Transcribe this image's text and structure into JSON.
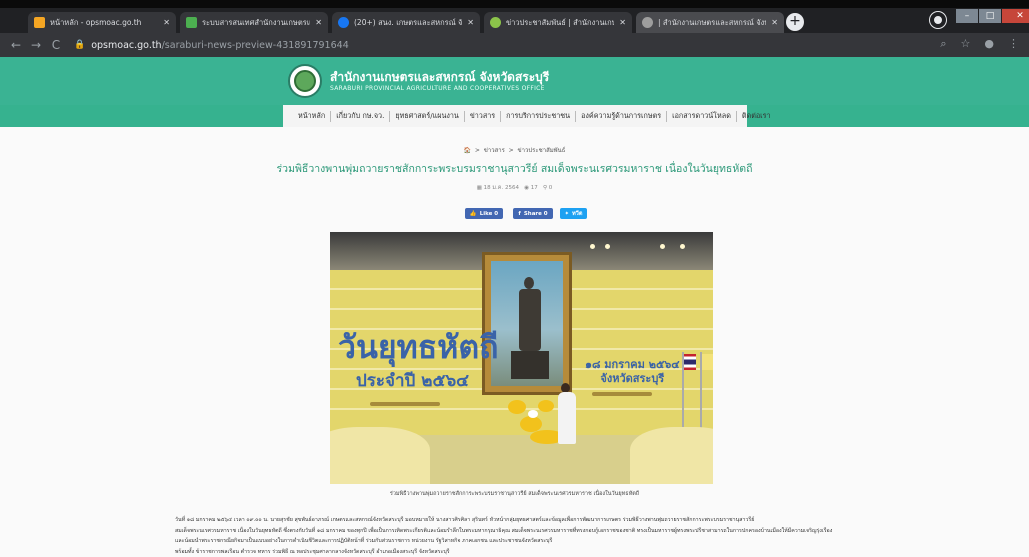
{
  "browser": {
    "tabs": [
      {
        "title": "หน้าหลัก - opsmoac.go.th",
        "favicon_color": "#f5a623"
      },
      {
        "title": "ระบบสารสนเทศสำนักงานเกษตรและสหกรณ์",
        "favicon_color": "#4caf50"
      },
      {
        "title": "(20+) สนง. เกษตรและสหกรณ์ จังหวัด",
        "favicon_color": "#1877f2"
      },
      {
        "title": "ข่าวประชาสัมพันธ์ | สำนักงานเกษตร",
        "favicon_color": "#8bc34a"
      },
      {
        "title": "| สำนักงานเกษตรและสหกรณ์ จังหวัด",
        "favicon_color": "#9e9e9e"
      }
    ],
    "new_tab": "+",
    "close_glyph": "✕",
    "url_domain": "opsmoac.go.th",
    "url_path": "/saraburi-news-preview-431891791644"
  },
  "site": {
    "title": "สำนักงานเกษตรและสหกรณ์ จังหวัดสระบุรี",
    "subtitle": "SARABURI PROVINCIAL AGRICULTURE AND COOPERATIVES OFFICE"
  },
  "menu": [
    "หน้าหลัก",
    "เกี่ยวกับ กษ.จว.",
    "ยุทธศาสตร์/แผนงาน",
    "ข่าวสาร",
    "การบริการประชาชน",
    "องค์ความรู้ด้านการเกษตร",
    "เอกสารดาวน์โหลด",
    "ติดต่อเรา"
  ],
  "breadcrumb": {
    "home_icon": "🏠",
    "items": [
      "ข่าวสาร",
      "ข่าวประชาสัมพันธ์"
    ]
  },
  "article": {
    "title": "ร่วมพิธีวางพานพุ่มถวายราชสักการะพระบรมราชานุสาวรีย์ สมเด็จพระนเรศวรมหาราช เนื่องในวันยุทธหัตถี",
    "date": "18 ม.ค. 2564",
    "views": "17",
    "shares": "0",
    "like_label": "Like 0",
    "share_label": "Share 0",
    "tweet_label": "ทวีต",
    "photo_text": {
      "main": "วันยุทธหัตถี",
      "sub": "ประจำปี ๒๕๖๔",
      "date_line1": "๑๘ มกราคม ๒๕๖๔",
      "date_line2": "จังหวัดสระบุรี"
    },
    "caption": "ร่วมพิธีวางพานพุ่มถวายราชสักการะพระบรมราชานุสาวรีย์ สมเด็จพระนเรศวรมหาราช เนื่องในวันยุทธหัตถี",
    "body": [
      "วันที่ ๑๘ มกราคม ๒๕๖๔ เวลา ๐๙.๐๐ น. นายสุรชัย สุขพันธ์อาภรณ์ เกษตรและสหกรณ์จังหวัดสระบุรี มอบหมายให้ นางสาวศิรศิลา สุรินทร์ หัวหน้ากลุ่มยุทธศาสตร์และข้อมูลเพื่อการพัฒนาการเกษตร ร่วมพิธีวางพานพุ่มถวายราชสักการะพระบรมราชานุสาวรีย์",
      "สมเด็จพระนเรศวรมหาราช เนื่องในวันยุทธหัตถี ซึ่งตรงกับวันที่ ๑๘ มกราคม ของทุกปี เพื่อเป็นการเทิดพระเกียรติและน้อมรำลึกในพระมหากรุณาธิคุณ สมเด็จพระนเรศวรมหาราชที่ทรงกอบกู้เอกราชของชาติ ทรงเป็นมหาราชผู้ทรงพระปรีชาสามารถในการปกครองบ้านเมืองให้มีความเจริญรุ่งเรือง",
      "และน้อมนำพระราชกรณียกิจมาเป็นแบบอย่างในการดำเนินชีวิตและการปฏิบัติหน้าที่ ร่วมกับส่วนราชการ หน่วยงาน รัฐวิสาหกิจ ภาคเอกชน และประชาชนจังหวัดสระบุรี",
      "พร้อมทั้ง ข้าราชการพลเรือน ตำรวจ ทหาร ร่วมพิธี ณ หอประชุมศาลากลางจังหวัดสระบุรี อำเภอเมืองสระบุรี จังหวัดสระบุรี"
    ]
  },
  "colors": {
    "brand_green": "#3ab393",
    "title_green": "#2b9878",
    "facebook": "#4267b2",
    "twitter": "#1da1f2"
  }
}
